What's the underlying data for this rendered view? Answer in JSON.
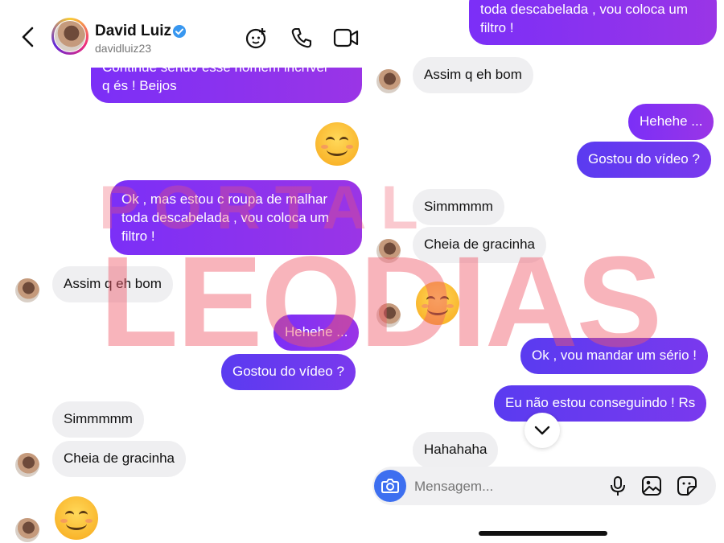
{
  "header": {
    "back_icon": "chevron-left-icon",
    "name": "David Luiz",
    "username": "davidluiz23",
    "verified_icon": "verified-badge-icon",
    "actions": [
      "video-effects-icon",
      "phone-icon",
      "video-camera-icon"
    ]
  },
  "left": {
    "messages": [
      {
        "who": "out",
        "text_1": "Continue sendo esse homem incrível",
        "text_2": "q és ! Beijos"
      },
      {
        "who": "out-emoji",
        "text": "😊"
      },
      {
        "who": "out",
        "text_1": "Ok , mas estou c roupa de malhar",
        "text_2": "toda descabelada , vou coloca um",
        "text_3": "filtro !"
      },
      {
        "who": "in",
        "text": "Assim q eh bom"
      },
      {
        "who": "out",
        "text": "Hehehe ..."
      },
      {
        "who": "out",
        "text": "Gostou do vídeo ?"
      },
      {
        "who": "in",
        "text": "Simmmmm"
      },
      {
        "who": "in",
        "text": "Cheia de gracinha"
      },
      {
        "who": "in-emoji",
        "text": "😊"
      }
    ]
  },
  "right": {
    "messages": [
      {
        "who": "out",
        "text_1": "toda descabelada , vou coloca um",
        "text_2": "filtro !"
      },
      {
        "who": "in",
        "text": "Assim q eh bom"
      },
      {
        "who": "out",
        "text": "Hehehe ..."
      },
      {
        "who": "out",
        "text": "Gostou do vídeo ?"
      },
      {
        "who": "in",
        "text": "Simmmmm"
      },
      {
        "who": "in",
        "text": "Cheia de gracinha"
      },
      {
        "who": "in-emoji",
        "text": "😊"
      },
      {
        "who": "out",
        "text": "Ok , vou mandar um sério !"
      },
      {
        "who": "out",
        "text": "Eu não estou conseguindo ! Rs"
      },
      {
        "who": "in",
        "text": "Hahahaha"
      }
    ],
    "composer": {
      "placeholder": "Mensagem...",
      "camera_icon": "camera-icon",
      "mic_icon": "microphone-icon",
      "gallery_icon": "image-icon",
      "sticker_icon": "sticker-icon"
    },
    "scroll_down_icon": "chevron-down-icon"
  },
  "watermark": {
    "line1": "PORTAL",
    "line2": "LEODIAS"
  },
  "colors": {
    "outgoing": "#8a33ee",
    "incoming": "#efeff1",
    "watermark": "#f05a6b",
    "camera_button": "#3d6ff0"
  }
}
